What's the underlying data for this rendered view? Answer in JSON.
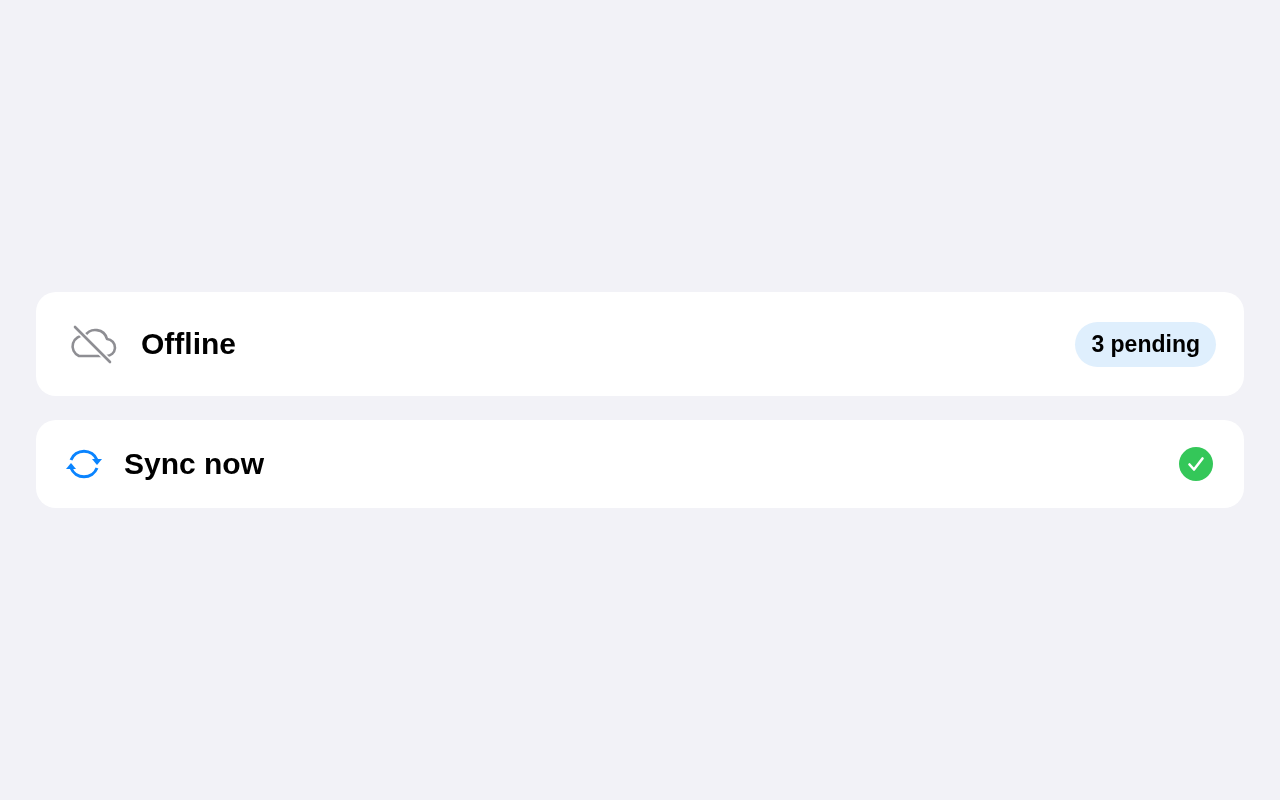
{
  "rows": [
    {
      "kind": "status",
      "label": "Offline",
      "badge": "3 pending"
    },
    {
      "kind": "action",
      "label": "Sync now",
      "completed": true
    }
  ]
}
